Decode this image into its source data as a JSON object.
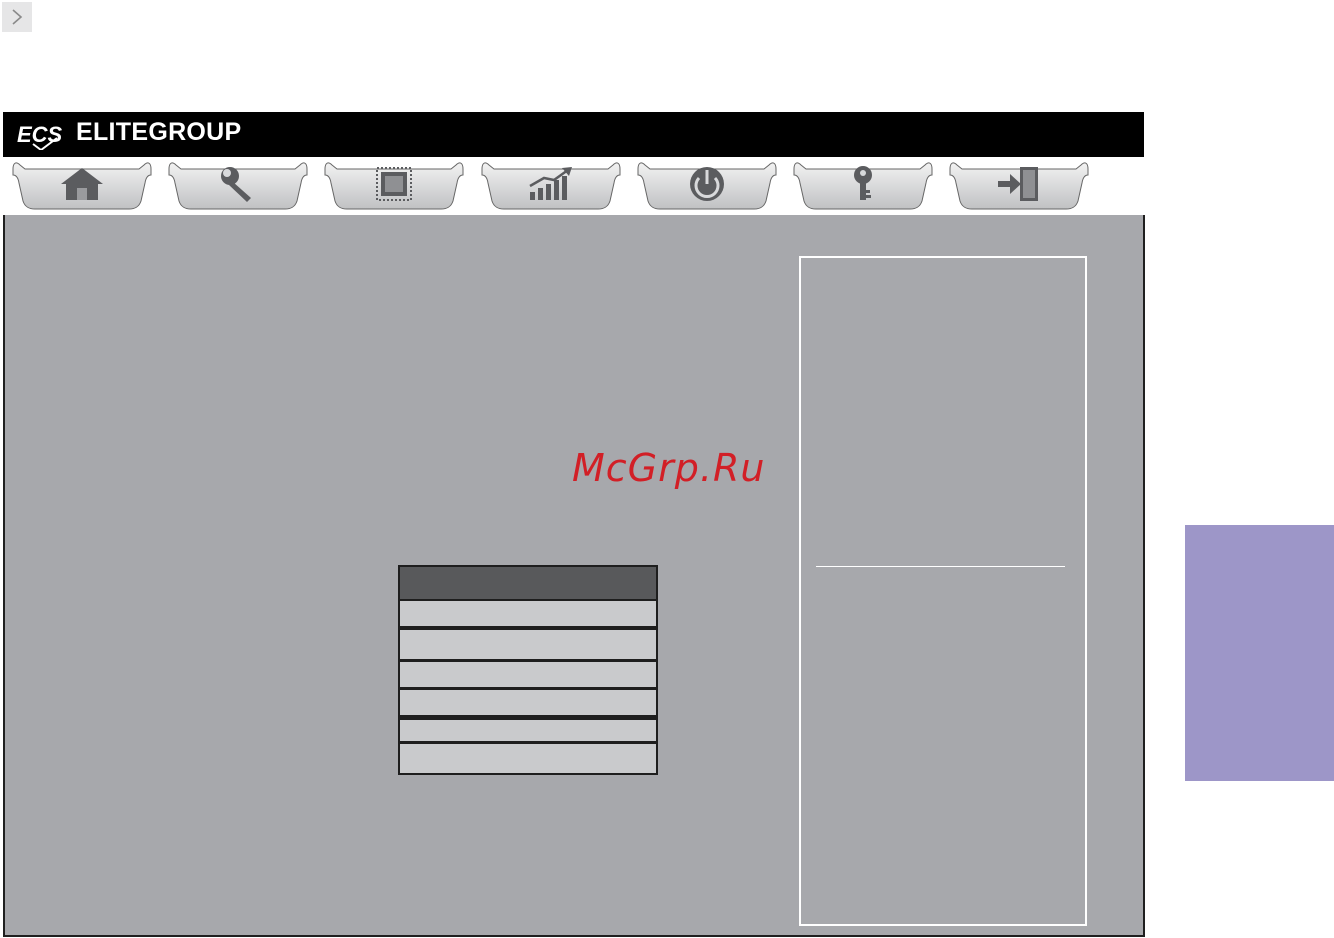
{
  "header": {
    "logo_text": "ECS",
    "brand_name": "ELITEGROUP"
  },
  "tabs": [
    {
      "icon": "home-icon"
    },
    {
      "icon": "wrench-icon"
    },
    {
      "icon": "chip-icon"
    },
    {
      "icon": "performance-chart-icon"
    },
    {
      "icon": "power-icon"
    },
    {
      "icon": "key-icon"
    },
    {
      "icon": "exit-icon"
    }
  ],
  "watermark": {
    "text": "McGrp.Ru"
  },
  "colors": {
    "panel": "#a7a8ac",
    "popup_header": "#58595b",
    "popup_row": "#c9cacc",
    "side_tab": "#9d96c8",
    "watermark": "#d21f26"
  }
}
